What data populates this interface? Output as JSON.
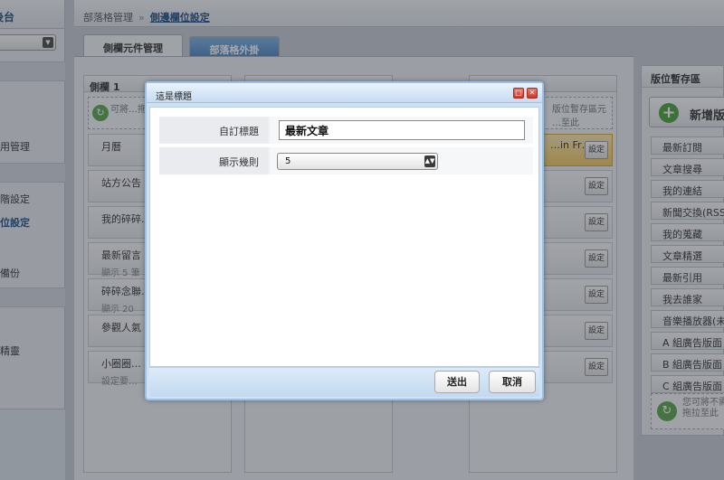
{
  "sidebar": {
    "header": "後台",
    "links": [
      "用管理",
      "階設定",
      "位設定",
      "備份",
      "精靈"
    ]
  },
  "topbar": {
    "crumb": "部落格管理",
    "separator": "»",
    "current": "側邊欄位設定"
  },
  "tabs": [
    "側欄元件管理",
    "部落格外掛"
  ],
  "columns": [
    {
      "title": "側欄 1",
      "hint": "可將…拖…",
      "widgets": [
        {
          "name": "月曆",
          "sub": ""
        },
        {
          "name": "站方公告",
          "sub": ""
        },
        {
          "name": "我的碎碎…",
          "sub": ""
        },
        {
          "name": "最新留言",
          "sub": "顯示 5 筆"
        },
        {
          "name": "碎碎念聯…",
          "sub": "顯示 20"
        },
        {
          "name": "參觀人氣",
          "sub": ""
        },
        {
          "name": "小圈圈…",
          "sub": "設定要…"
        }
      ]
    },
    {
      "title": "",
      "widgets": []
    },
    {
      "title": "",
      "hint": "版位暫存區元 …至此",
      "widgets": [
        {
          "name": "…in Fr…",
          "sub": "",
          "highlight": true
        },
        {
          "name": "",
          "sub": ""
        },
        {
          "name": "",
          "sub": ""
        },
        {
          "name": "",
          "sub": ""
        },
        {
          "name": "",
          "sub": ""
        },
        {
          "name": "",
          "sub": ""
        },
        {
          "name": "",
          "sub": ""
        }
      ]
    }
  ],
  "set_label": "設定",
  "right_panel": {
    "title": "版位暫存區",
    "add_label": "新增版",
    "items": [
      "最新訂閱",
      "文章搜尋",
      "我的連結",
      "新聞交換(RSS",
      "我的蒐藏",
      "文章精選",
      "最新引用",
      "我去誰家",
      "音樂播放器(未",
      "A 組廣告版面",
      "B 組廣告版面",
      "C 組廣告版面"
    ],
    "hint_line1": "您可將不需",
    "hint_line2": "拖拉至此"
  },
  "modal": {
    "title": "這是標題",
    "fields": {
      "custom_title_label": "自訂標題",
      "custom_title_value": "最新文章",
      "display_count_label": "顯示幾則",
      "display_count_value": "5"
    },
    "submit_label": "送出",
    "cancel_label": "取消"
  }
}
